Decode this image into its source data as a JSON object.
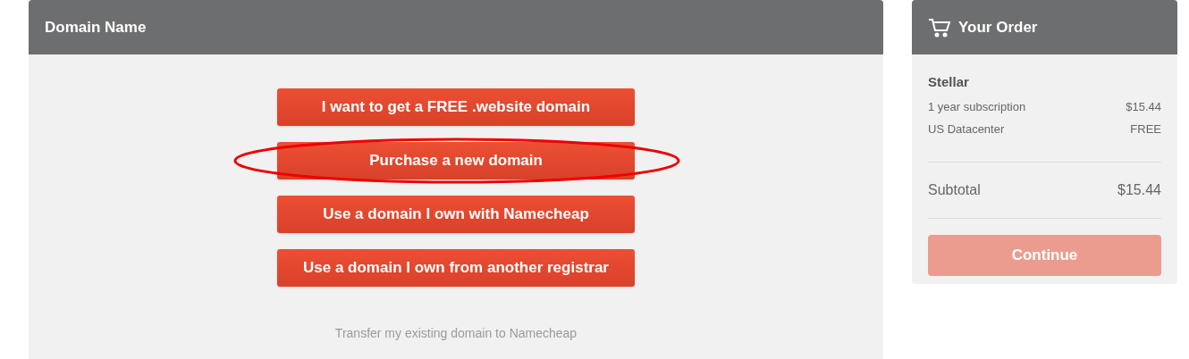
{
  "domain_panel": {
    "title": "Domain Name",
    "options": [
      {
        "label": "I want to get a FREE .website domain",
        "highlighted": false
      },
      {
        "label": "Purchase a new domain",
        "highlighted": true
      },
      {
        "label": "Use a domain I own with Namecheap",
        "highlighted": false
      },
      {
        "label": "Use a domain I own from another registrar",
        "highlighted": false
      }
    ],
    "transfer_link": "Transfer my existing domain to Namecheap"
  },
  "order": {
    "title": "Your Order",
    "product": "Stellar",
    "lines": [
      {
        "label": "1 year subscription",
        "value": "$15.44"
      },
      {
        "label": "US Datacenter",
        "value": "FREE"
      }
    ],
    "subtotal": {
      "label": "Subtotal",
      "value": "$15.44"
    },
    "continue": {
      "label": "Continue",
      "disabled": true
    }
  }
}
